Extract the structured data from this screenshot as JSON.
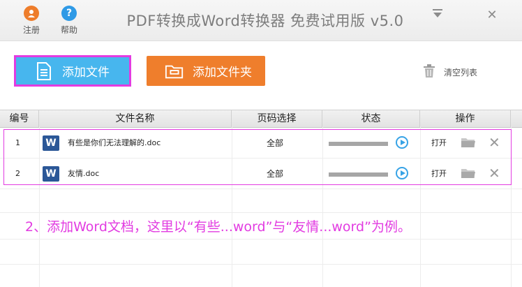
{
  "app": {
    "title": "PDF转换成Word转换器 免费试用版 v5.0",
    "register_label": "注册",
    "help_label": "帮助",
    "colors": {
      "accent_blue": "#47b6ee",
      "accent_orange": "#ef7e2c",
      "highlight_magenta": "#e23be1"
    }
  },
  "toolbar": {
    "add_file_label": "添加文件",
    "add_folder_label": "添加文件夹",
    "clear_list_label": "清空列表"
  },
  "table": {
    "headers": [
      "编号",
      "文件名称",
      "页码选择",
      "状态",
      "操作"
    ],
    "rows": [
      {
        "index": "1",
        "filename": "有些是你们无法理解的.doc",
        "pages": "全部",
        "action": "打开"
      },
      {
        "index": "2",
        "filename": "友情.doc",
        "pages": "全部",
        "action": "打开"
      }
    ]
  },
  "caption": "2、添加Word文档，这里以“有些...word”与“友情...word”为例。"
}
